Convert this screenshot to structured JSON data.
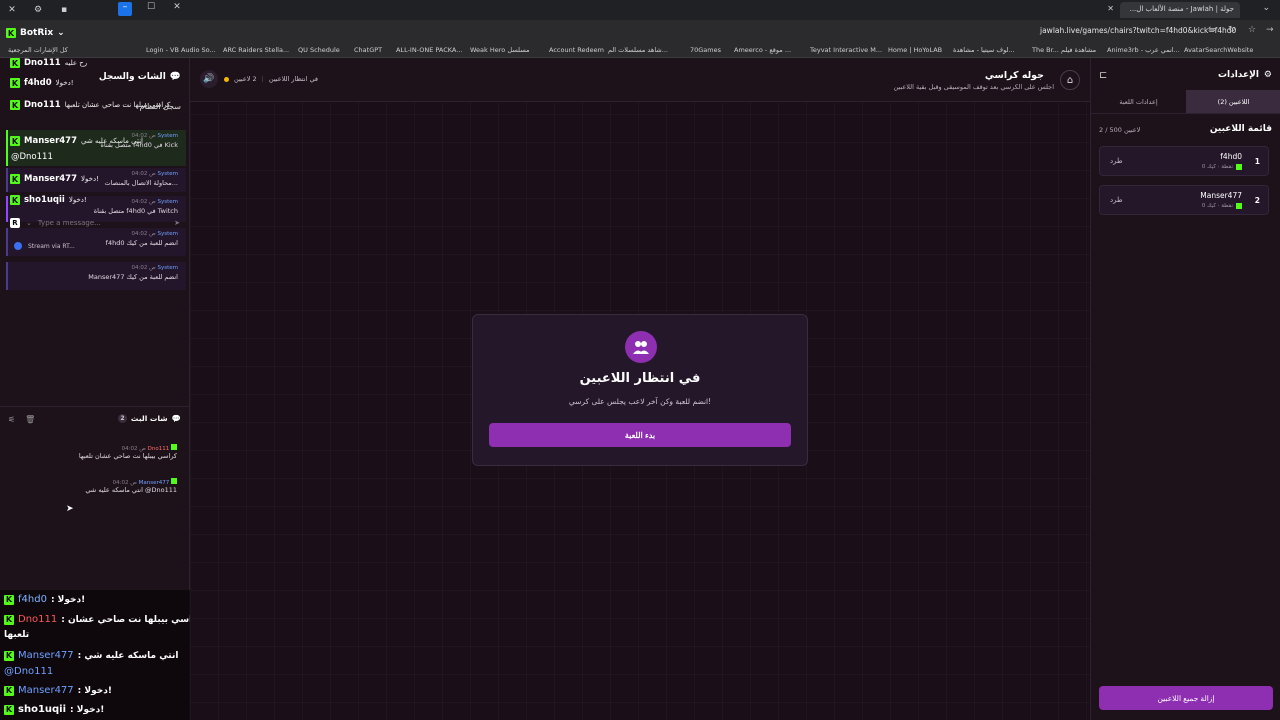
{
  "browser": {
    "tab_title": "جولة | Jawlah - منصة الألعاب ال...",
    "url": "jawlah.live/games/chairs?twitch=f4hd0&kick=f4hd0",
    "bookmarks": [
      "Login - VB Audio So...",
      "ARC Raiders Stella...",
      "QU Schedule",
      "ChatGPT",
      "ALL-IN-ONE PACKA...",
      "Weak Hero مسلسل",
      "Account Redeem",
      "شاهد مسلسلات الم...",
      "70Games",
      "Ameerco - موقع ...",
      "Teyvat Interactive M...",
      "Home | HoYoLAB",
      "لوف سيتيا - مشاهدة...",
      "The Br... مشاهدة فيلم",
      "Anime3rb - انمي عرب...",
      "AvatarSearchWebsite",
      "كل الإشارات المرجعية"
    ]
  },
  "botrix": {
    "label": "BotRix"
  },
  "left": {
    "header": "الشات والسجل",
    "sub_header": "سجل النظام",
    "overlay_names": [
      {
        "name": "Dno111",
        "msg": "رح عليه"
      },
      {
        "name": "f4hd0",
        "msg": "دخولا!"
      },
      {
        "name": "Dno111",
        "msg": "كراسي بيبلها نت صاحي عشان تلعبها"
      }
    ],
    "logs": [
      {
        "sender": "System",
        "time": "04:02 ص",
        "text": "متصل بقناة f4hd0 في Kick"
      },
      {
        "sender": "System",
        "time": "04:02 ص",
        "text": "محاولة الاتصال بالمنصات..."
      },
      {
        "sender": "System",
        "time": "04:02 ص",
        "text": "متصل بقناة f4hd0 في Twitch"
      },
      {
        "sender": "System",
        "time": "04:02 ص",
        "text": "f4hd0 انضم للعبة من كيك"
      },
      {
        "sender": "System",
        "time": "04:02 ص",
        "text": "Manser477 انضم للعبة من كيك"
      }
    ],
    "log_overlays": [
      {
        "name": "Manser477",
        "msg": "انتي ماسكه عليه شي"
      },
      {
        "name": "@Dno111",
        "msg": ""
      },
      {
        "name": "Manser477",
        "msg": "دخولا!"
      },
      {
        "name": "sho1uqii",
        "msg": "دخولا!"
      }
    ],
    "input_placeholder": "Type a message...",
    "stream_label": "Stream via RT...",
    "bots": {
      "header": "شات البث",
      "count": "2",
      "messages": [
        {
          "name": "Dno111",
          "time": "04:02 ص",
          "text": "كراسي بيبلها نت صاحي عشان تلعبها"
        },
        {
          "name": "Manser477",
          "time": "04:02 ص",
          "text": "انتي ماسكه عليه شي @Dno111"
        }
      ]
    }
  },
  "overlay_chat": [
    {
      "name": "f4hd0",
      "text": ": دخولا!"
    },
    {
      "name": "Dno111",
      "text": ": كراسي بيبلها نت صاحي عشان"
    },
    {
      "name": "",
      "text": "تلعبها"
    },
    {
      "name": "Manser477",
      "text": ": انتي ماسكه عليه شي"
    },
    {
      "name": "@Dno111",
      "text": ""
    },
    {
      "name": "Manser477",
      "text": ": دخولا!"
    },
    {
      "name": "sho1uqii",
      "text": ": دخولا!"
    }
  ],
  "main": {
    "title": "جوله كراسي",
    "subtitle": "اجلس على الكرسي بعد توقف الموسيقى وقبل بقية اللاعبين",
    "status": "في انتظار اللاعبين",
    "players_count": "2 لاعبين",
    "card": {
      "title": "في انتظار اللاعبين",
      "subtitle": "انضم للعبة وكن آخر لاعب يجلس على كرسي!",
      "start_button": "بدء اللعبة"
    }
  },
  "right": {
    "title": "الإعدادات",
    "tabs": [
      "اللاعبين (2)",
      "إعدادات اللعبة"
    ],
    "list_title": "قائمة اللاعبين",
    "list_count": "2 / 500 لاعبين",
    "players": [
      {
        "num": "1",
        "name": "f4hd0",
        "meta": "0 نقطة · كيك",
        "kick": "طرد"
      },
      {
        "num": "2",
        "name": "Manser477",
        "meta": "0 نقطة · كيك",
        "kick": "طرد"
      }
    ],
    "remove_all": "إزالة جميع اللاعبين"
  },
  "colors": {
    "accent": "#8d2fb0",
    "kick_green": "#53fc18",
    "bg": "#1a0f18"
  }
}
